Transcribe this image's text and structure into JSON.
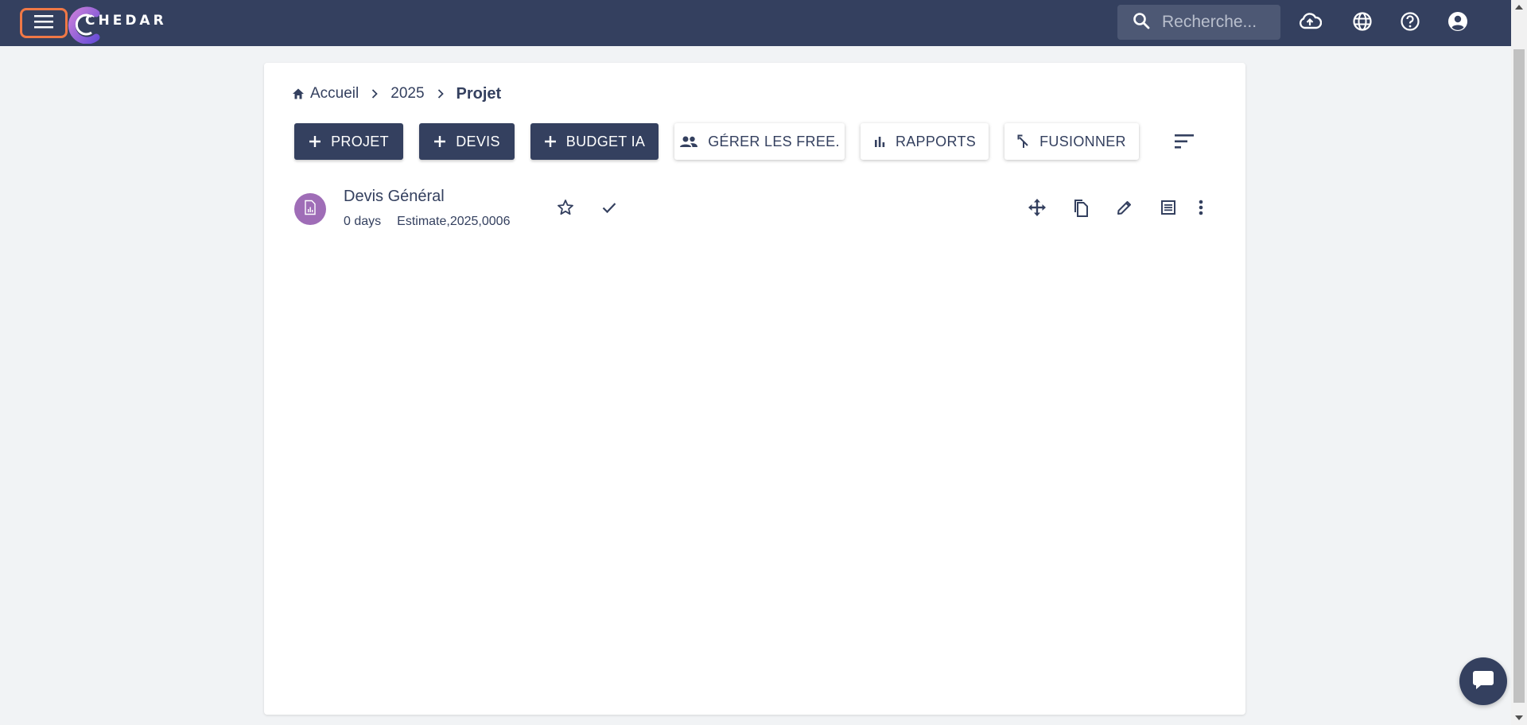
{
  "app": {
    "logo_text": "CHEDAR",
    "search_placeholder": "Recherche..."
  },
  "topbar_icons": [
    "menu-icon",
    "cloud-upload-icon",
    "globe-icon",
    "help-icon",
    "account-icon"
  ],
  "breadcrumb": {
    "home": "Accueil",
    "year": "2025",
    "current": "Projet"
  },
  "actions": {
    "projet": "PROJET",
    "devis": "DEVIS",
    "budget_ia": "BUDGET IA",
    "gerer_free": "GÉRER LES FREE.",
    "rapports": "RAPPORTS",
    "fusionner": "FUSIONNER"
  },
  "items": [
    {
      "title": "Devis Général",
      "duration": "0 days",
      "reference": "Estimate,2025,0006",
      "icon": "document-chart-icon"
    }
  ],
  "colors": {
    "primary": "#34405f",
    "accent_focus": "#f07846",
    "avatar": "#9f6db7",
    "background": "#f1f3f5"
  }
}
